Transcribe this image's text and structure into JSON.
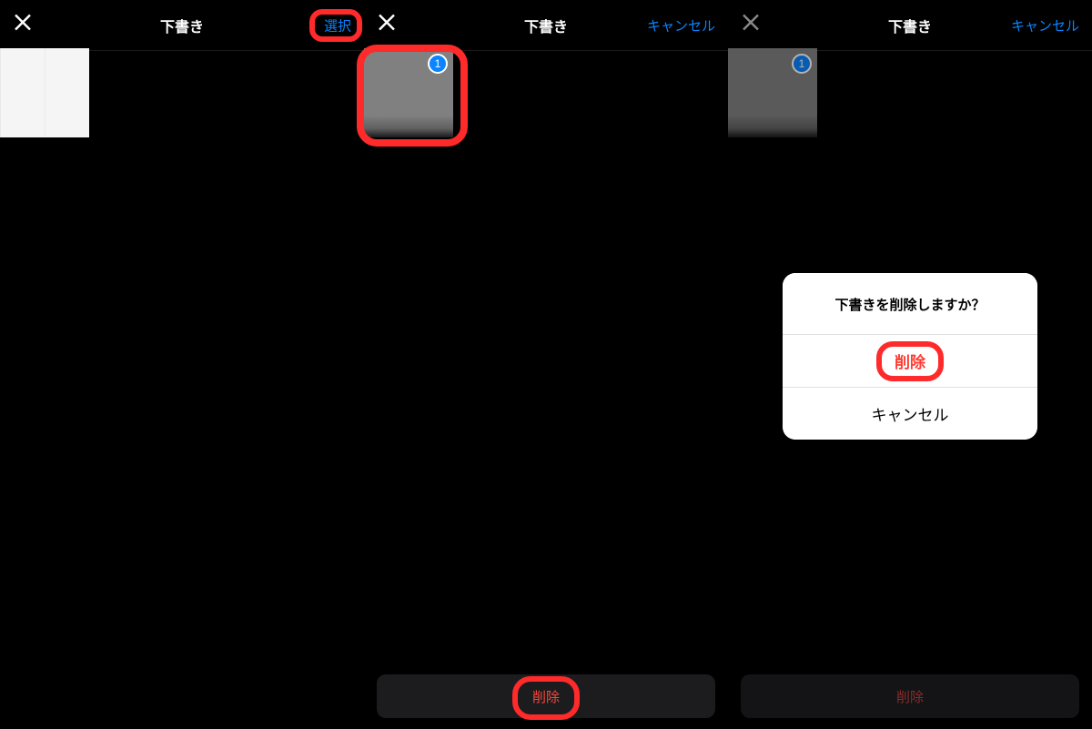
{
  "panels": [
    {
      "title": "下書き",
      "right_action": "選択",
      "close_visible": true,
      "close_dim": false,
      "thumb_selected": false,
      "badge": null,
      "right_highlight": true,
      "thumb_highlight": false,
      "footer_delete": null,
      "footer_highlight": false,
      "dim": false,
      "action_sheet": null
    },
    {
      "title": "下書き",
      "right_action": "キャンセル",
      "close_visible": true,
      "close_dim": false,
      "thumb_selected": true,
      "badge": "1",
      "right_highlight": false,
      "thumb_highlight": true,
      "footer_delete": "削除",
      "footer_highlight": true,
      "dim": false,
      "action_sheet": null
    },
    {
      "title": "下書き",
      "right_action": "キャンセル",
      "close_visible": true,
      "close_dim": true,
      "thumb_selected": true,
      "badge": "1",
      "right_highlight": false,
      "thumb_highlight": false,
      "footer_delete": "削除",
      "footer_highlight": false,
      "dim": true,
      "action_sheet": {
        "title": "下書きを削除しますか？",
        "delete": "削除",
        "cancel": "キャンセル"
      }
    }
  ]
}
